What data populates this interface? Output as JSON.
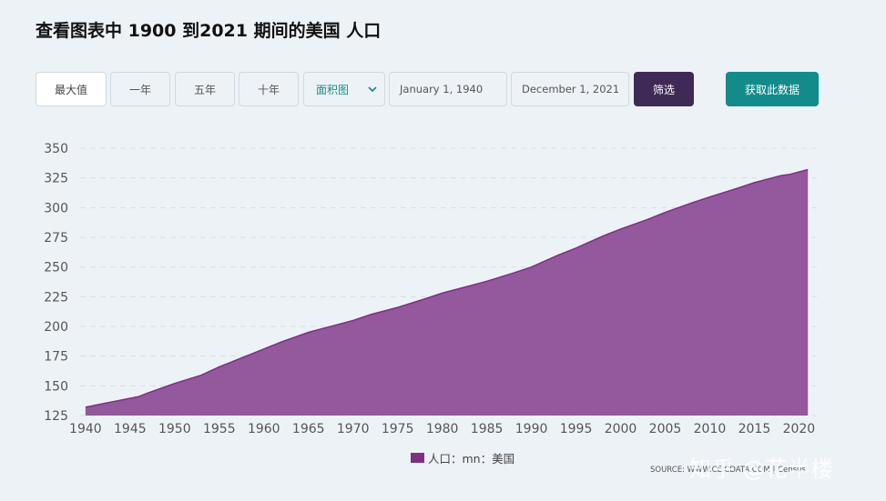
{
  "page": {
    "title": "查看图表中 1900 到2021 期间的美国 人口"
  },
  "toolbar": {
    "range_buttons": [
      "最大值",
      "一年",
      "五年",
      "十年"
    ],
    "chart_type_select": "面积图",
    "date_from": "January 1, 1940",
    "date_to": "December 1, 2021",
    "filter_label": "筛选",
    "get_data_label": "获取此数据"
  },
  "colors": {
    "area_fill": "#8f4f97",
    "area_stroke": "#7f2f84",
    "filter_button": "#3f2a57",
    "get_data_button": "#138b8b"
  },
  "chart_data": {
    "type": "area",
    "x": [
      1940,
      1942,
      1944,
      1946,
      1947,
      1950,
      1953,
      1955,
      1958,
      1960,
      1962,
      1965,
      1968,
      1970,
      1972,
      1975,
      1978,
      1980,
      1983,
      1985,
      1988,
      1990,
      1993,
      1995,
      1998,
      2000,
      2003,
      2005,
      2008,
      2010,
      2013,
      2015,
      2018,
      2019,
      2021
    ],
    "series": [
      {
        "name": "人口：mn：美国",
        "values": [
          132,
          135,
          138,
          141,
          144,
          152,
          159,
          166,
          175,
          181,
          187,
          195,
          201,
          205,
          210,
          216,
          223,
          228,
          234,
          238,
          245,
          250,
          260,
          266,
          276,
          282,
          290,
          296,
          304,
          309,
          316,
          321,
          327,
          328,
          332
        ]
      }
    ],
    "ylim": [
      125,
      350
    ],
    "yticks": [
      125,
      150,
      175,
      200,
      225,
      250,
      275,
      300,
      325,
      350
    ],
    "xticks": [
      1940,
      1945,
      1950,
      1955,
      1960,
      1965,
      1970,
      1975,
      1980,
      1985,
      1990,
      1995,
      2000,
      2005,
      2010,
      2015,
      2020
    ],
    "grid": true,
    "legend_position": "bottom",
    "source": "SOURCE: WWW.CEICDATA.COM | Census"
  },
  "watermark": "知乎 @花半楼"
}
